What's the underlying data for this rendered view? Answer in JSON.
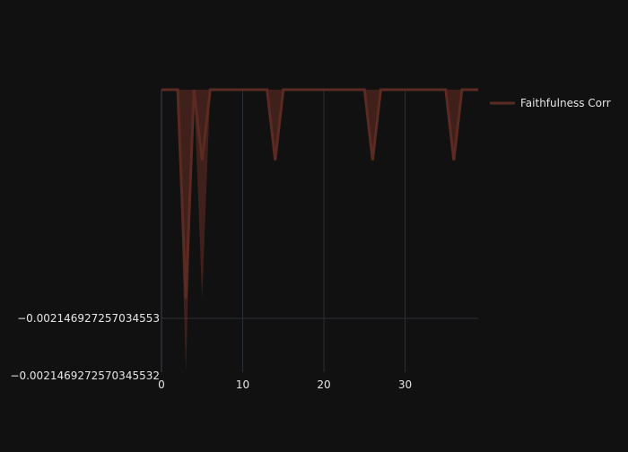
{
  "chart_data": {
    "type": "line",
    "title": "",
    "xlabel": "",
    "ylabel": "",
    "grid": true,
    "legend_placement": "top-right",
    "background": "#111111",
    "series_color": "#5b2a22",
    "band_color": "#7a3426",
    "x_ticks": [
      "0",
      "10",
      "20",
      "30"
    ],
    "x_tick_values": [
      0,
      10,
      20,
      30
    ],
    "xlim": [
      0,
      39
    ],
    "y_tick_labels": [
      "−0.002146927257034553",
      "−0.0021469272570345532"
    ],
    "series": [
      {
        "name": "Faithfulness Corr",
        "x": [
          0,
          1,
          2,
          3,
          4,
          5,
          6,
          7,
          8,
          9,
          10,
          11,
          12,
          13,
          14,
          15,
          16,
          17,
          18,
          19,
          20,
          21,
          22,
          23,
          24,
          25,
          26,
          27,
          28,
          29,
          30,
          31,
          32,
          33,
          34,
          35,
          36,
          37,
          38,
          39
        ],
        "values": [
          0,
          0,
          0,
          -0.74,
          0,
          -0.25,
          0,
          0,
          0,
          0,
          0,
          0,
          0,
          0,
          -0.25,
          0,
          0,
          0,
          0,
          0,
          0,
          0,
          0,
          0,
          0,
          0,
          -0.25,
          0,
          0,
          0,
          0,
          0,
          0,
          0,
          0,
          0,
          -0.25,
          0,
          0,
          0
        ],
        "band_lower": [
          0,
          0,
          0,
          -1,
          0,
          -0.74,
          0,
          0,
          0,
          0,
          0,
          0,
          0,
          0,
          -0.25,
          0,
          0,
          0,
          0,
          0,
          0,
          0,
          0,
          0,
          0,
          0,
          -0.25,
          0,
          0,
          0,
          0,
          0,
          0,
          0,
          0,
          0,
          -0.25,
          0,
          0,
          0
        ],
        "band_upper": [
          0,
          0,
          0,
          0,
          0,
          0,
          0,
          0,
          0,
          0,
          0,
          0,
          0,
          0,
          0,
          0,
          0,
          0,
          0,
          0,
          0,
          0,
          0,
          0,
          0,
          0,
          0,
          0,
          0,
          0,
          0,
          0,
          0,
          0,
          0,
          0,
          0,
          0,
          0,
          0
        ]
      }
    ]
  }
}
